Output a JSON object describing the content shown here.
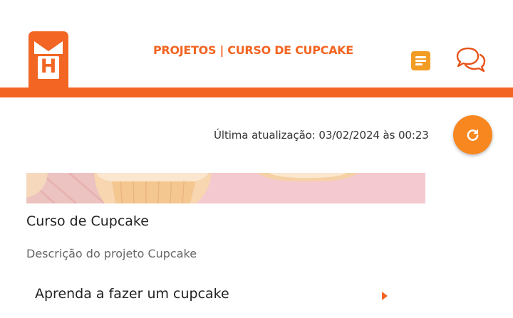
{
  "header": {
    "logo_letter": "H",
    "title": "PROJETOS | CURSO DE CUPCAKE",
    "icons": [
      "document-icon",
      "chat-bubbles-icon"
    ]
  },
  "update": {
    "text": "Última atualização: 03/02/2024 às 00:23",
    "refresh_icon": "refresh-icon"
  },
  "course": {
    "title": "Curso de Cupcake",
    "description": "Descrição do projeto Cupcake",
    "lessons": [
      {
        "label": "Aprenda a fazer um cupcake",
        "icon": "chevron-right-icon"
      }
    ]
  },
  "colors": {
    "brand_orange": "#f26522",
    "accent_orange": "#f7871e",
    "banner_pink": "#f4c9cf"
  }
}
